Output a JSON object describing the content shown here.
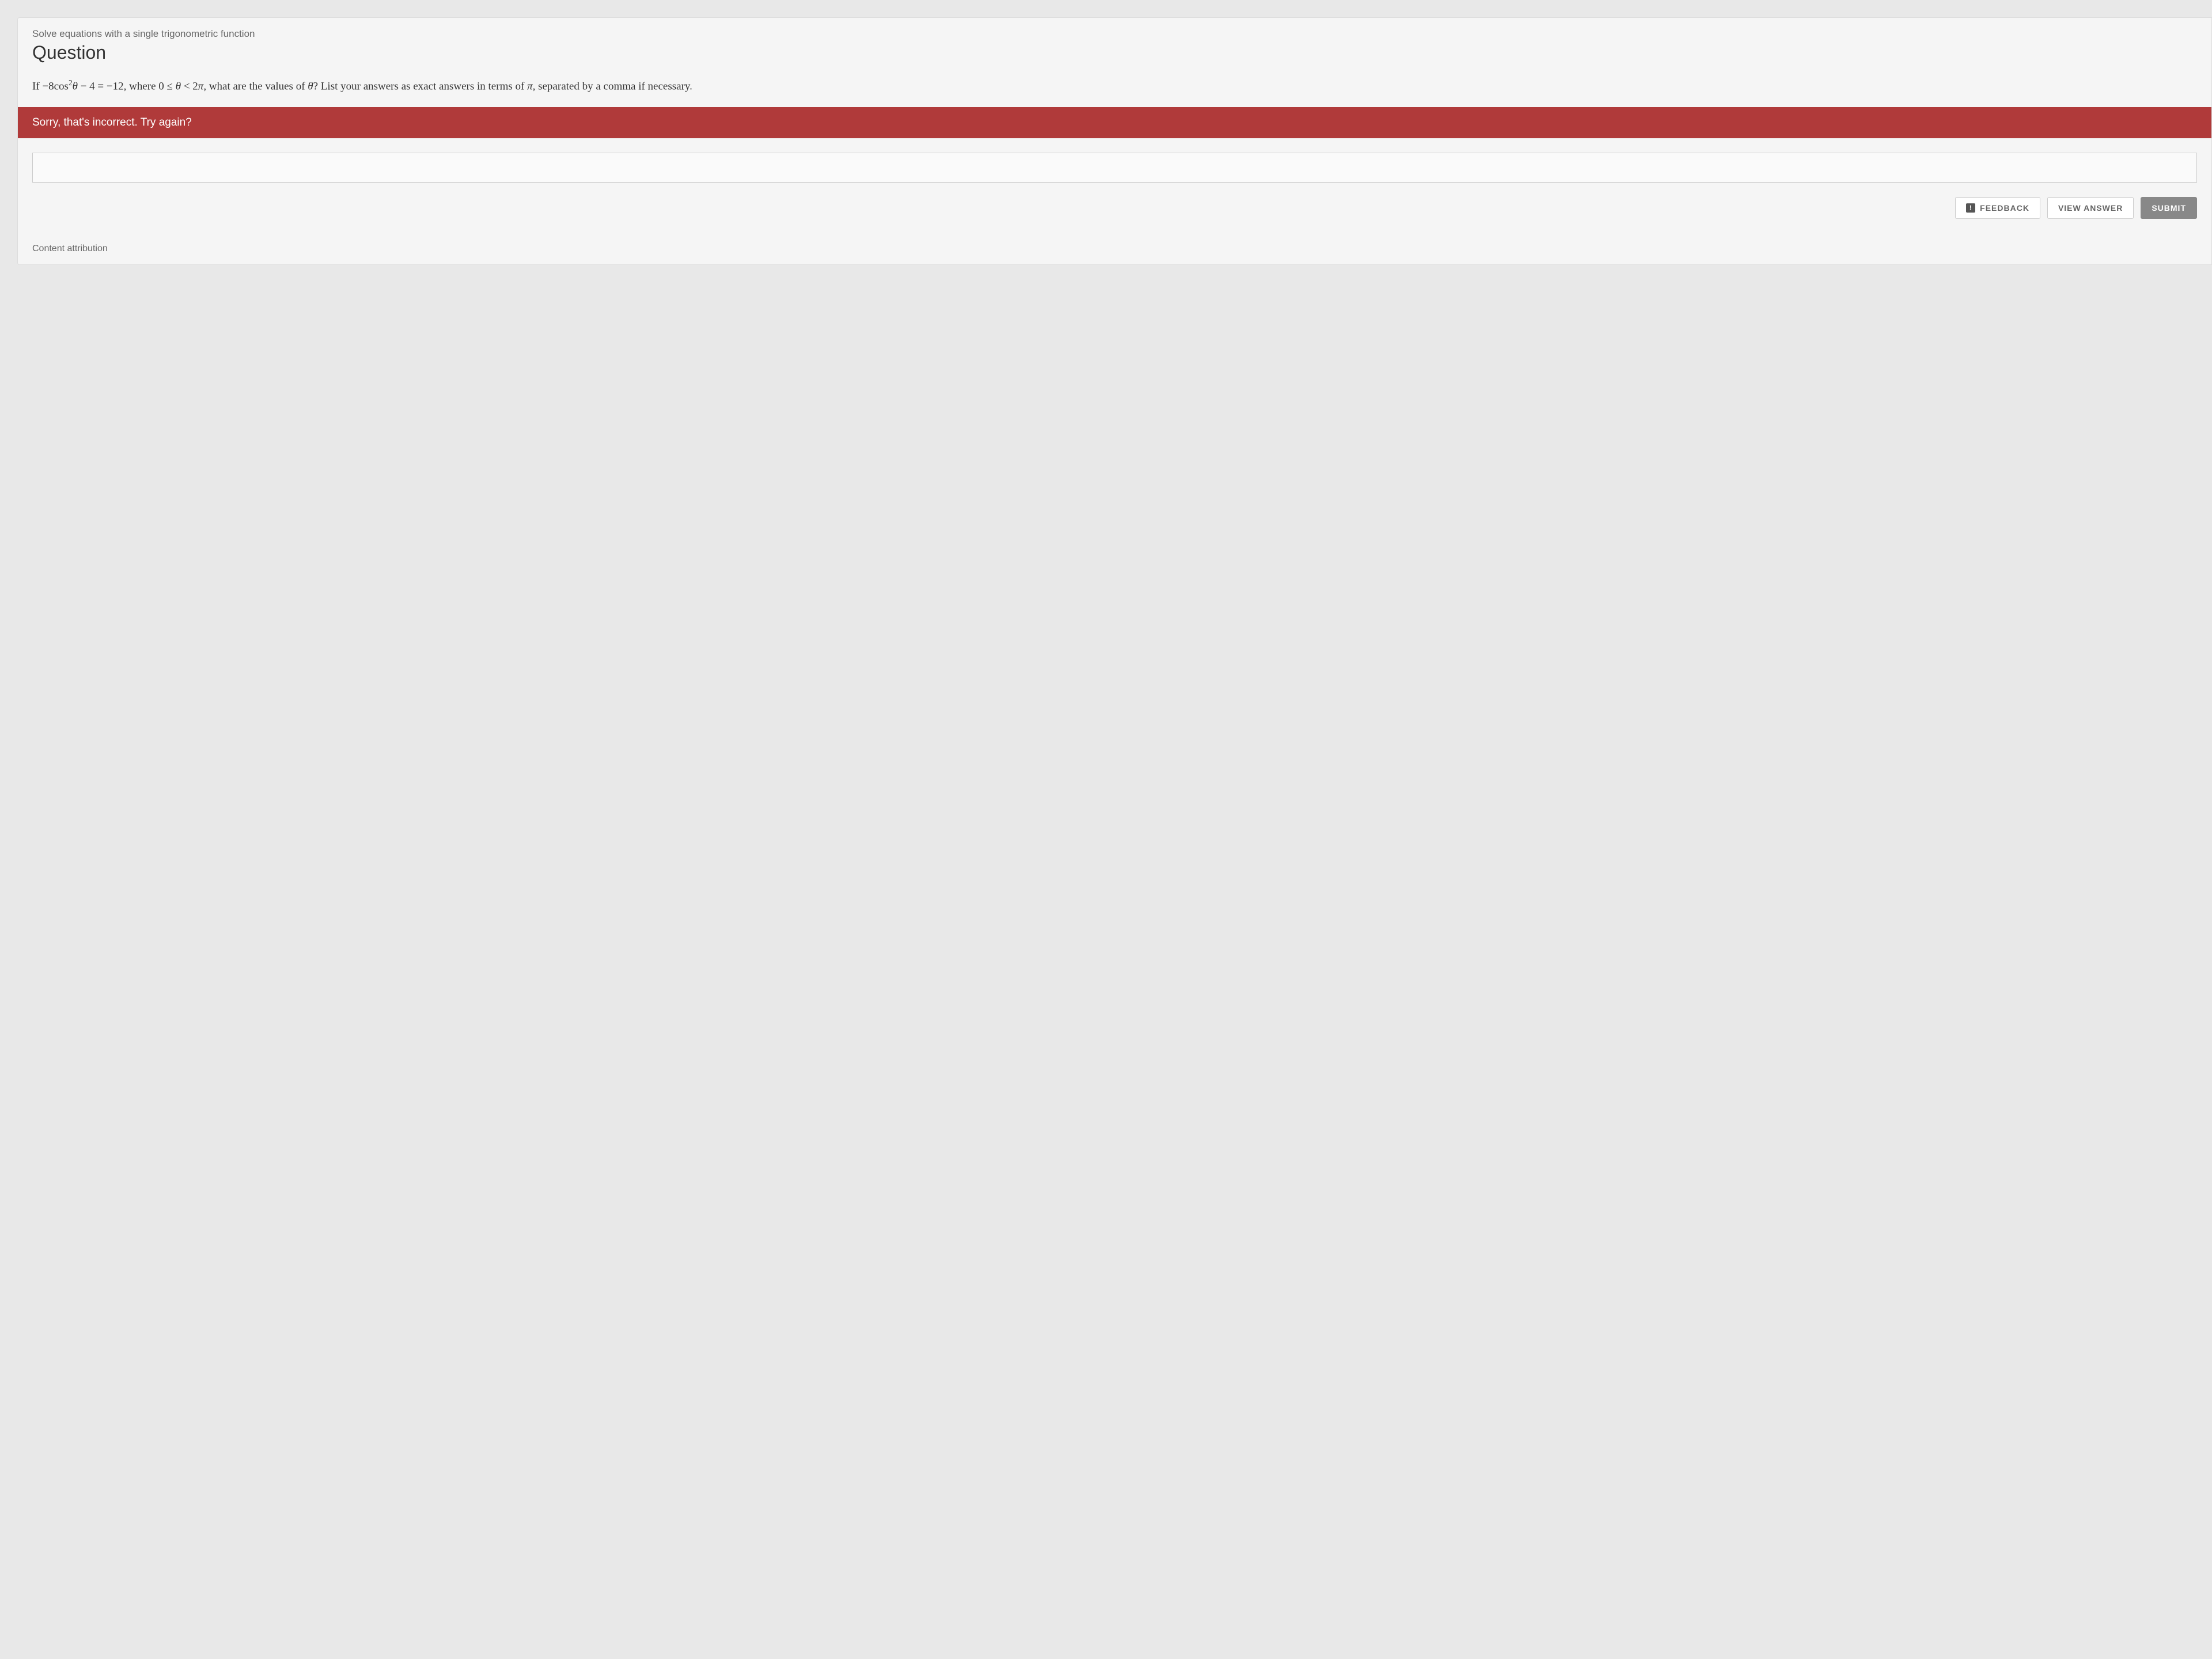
{
  "topic": "Solve equations with a single trigonometric function",
  "question_heading": "Question",
  "question": {
    "prefix": "If ",
    "equation_lhs_coeff": "−8cos",
    "equation_exp": "2",
    "equation_var": "θ",
    "equation_mid": " − 4 = −12",
    "where": ", where ",
    "domain_low": "0 ≤ ",
    "domain_var": "θ",
    "domain_high": " < 2",
    "pi1": "π",
    "suffix1": ", what are the values of ",
    "var2": "θ",
    "suffix2": "? List your answers as exact answers in terms of ",
    "pi2": "π",
    "suffix3": ", separated by a comma if necessary."
  },
  "error_message": "Sorry, that's incorrect. Try again?",
  "answer_value": "",
  "buttons": {
    "feedback": "FEEDBACK",
    "view_answer": "VIEW ANSWER",
    "submit": "SUBMIT"
  },
  "attribution": "Content attribution"
}
